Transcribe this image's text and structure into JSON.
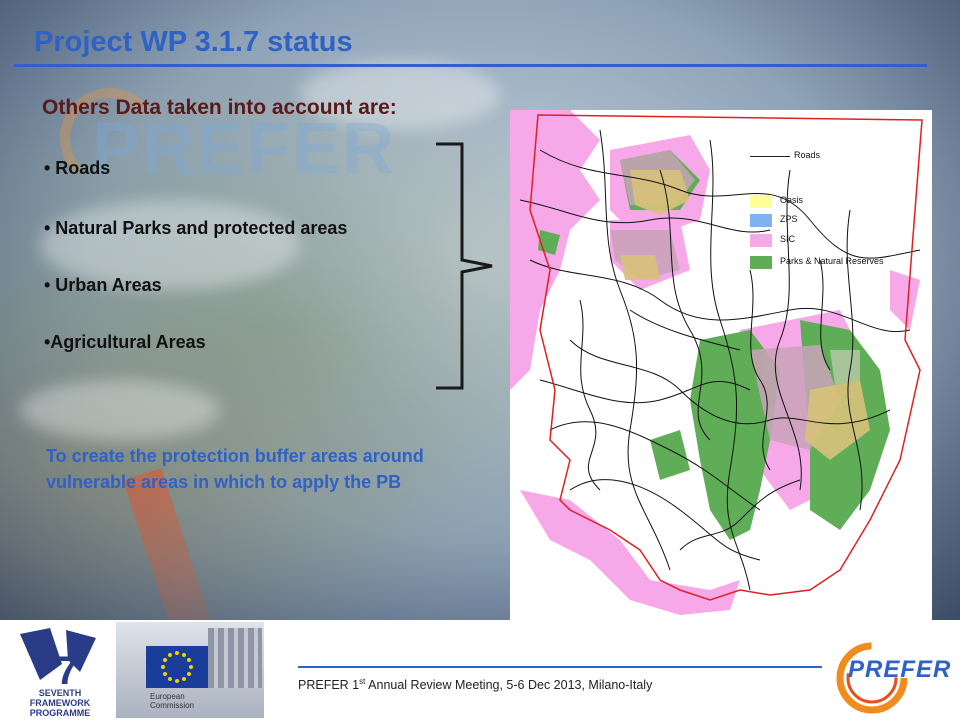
{
  "slide": {
    "title": "Project WP 3.1.7 status",
    "watermark": "PREFER"
  },
  "content": {
    "heading": "Others Data taken into account are:",
    "bullets": [
      "• Roads",
      "• Natural Parks and protected areas",
      "• Urban Areas",
      "•Agricultural Areas"
    ],
    "note": "To create the protection buffer areas around vulnerable areas in which to apply the PB"
  },
  "map": {
    "legend": [
      {
        "label": "Roads",
        "kind": "line",
        "color": "#222222"
      },
      {
        "label": "Oasis",
        "kind": "swatch",
        "color": "#ffff99"
      },
      {
        "label": "ZPS",
        "kind": "swatch",
        "color": "#7fb2f0"
      },
      {
        "label": "SIC",
        "kind": "swatch",
        "color": "#f7a8e8"
      },
      {
        "label": "Parks & Natural Reserves",
        "kind": "swatch",
        "color": "#5fad56"
      }
    ],
    "boundary_color": "#e02020"
  },
  "footer": {
    "meeting_prefix": "PREFER 1",
    "meeting_sup": "st",
    "meeting_suffix": " Annual Review Meeting, 5-6 Dec 2013, Milano-Italy",
    "fp7_label": "SEVENTH FRAMEWORK PROGRAMME",
    "fp7_number": "7",
    "ec_label_1": "European",
    "ec_label_2": "Commission",
    "logo_text": "PREFER"
  },
  "colors": {
    "title": "#2f62c6",
    "heading": "#5b1a1a",
    "note": "#2f62c6"
  }
}
